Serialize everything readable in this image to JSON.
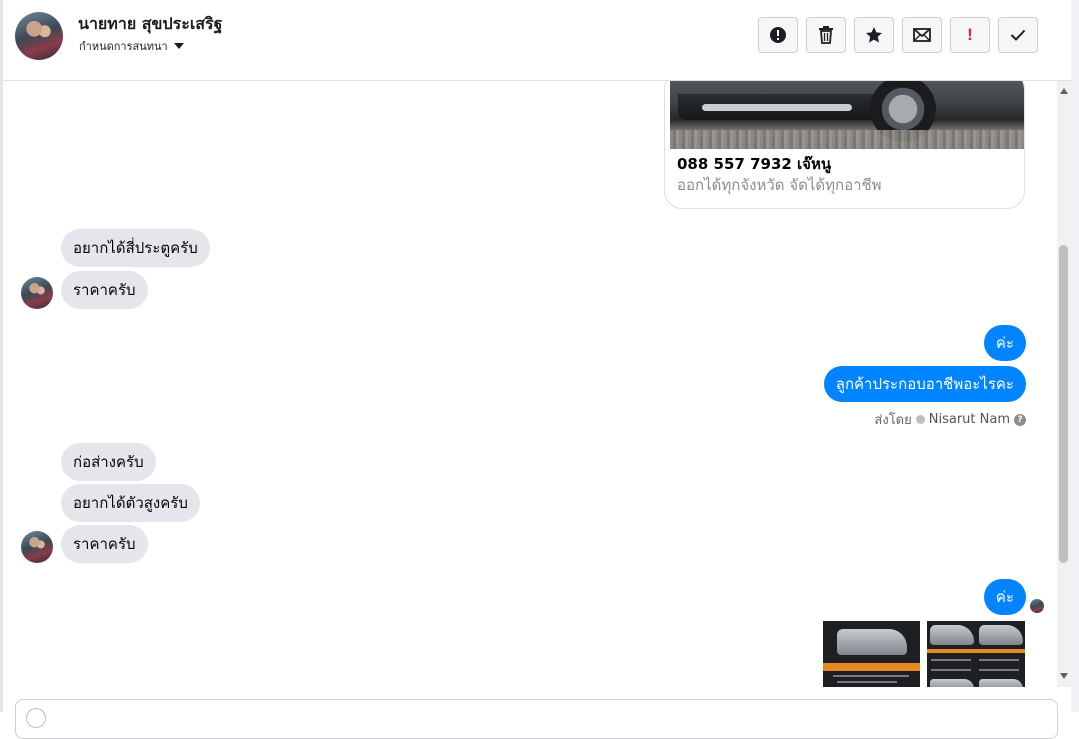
{
  "header": {
    "name": "นายทาย สุขประเสริฐ",
    "subtitle": "กำหนดการสนทนา",
    "buttons": [
      {
        "id": "spam",
        "icon": "alert-circle-icon"
      },
      {
        "id": "delete",
        "icon": "trash-icon"
      },
      {
        "id": "star",
        "icon": "star-icon"
      },
      {
        "id": "mail",
        "icon": "envelope-icon"
      },
      {
        "id": "important",
        "icon": "exclamation-icon",
        "label": "!"
      },
      {
        "id": "done",
        "icon": "check-icon"
      }
    ]
  },
  "card": {
    "title": "088 557 7932 เจ๊หนู",
    "subtitle": "ออกได้ทุกจังหวัด จัดได้ทุกอาชีพ"
  },
  "messages": {
    "in_1": "อยากได้สี่ประตูครับ",
    "in_2": "ราคาครับ",
    "out_1": "ค่ะ",
    "out_2": "ลูกค้าประกอบอาชีพอะไรคะ",
    "in_3": "ก่อส่างครับ",
    "in_4": "อยากได้ตัวสูงครับ",
    "in_5": "ราคาครับ",
    "out_3": "ค่ะ"
  },
  "sent_by": {
    "label": "ส่งโดย",
    "agent": "Nisarut Nam",
    "help": "?"
  },
  "colors": {
    "outgoing_bubble": "#0084ff",
    "incoming_bubble": "#e4e6eb",
    "important_red": "#e41e3f"
  }
}
